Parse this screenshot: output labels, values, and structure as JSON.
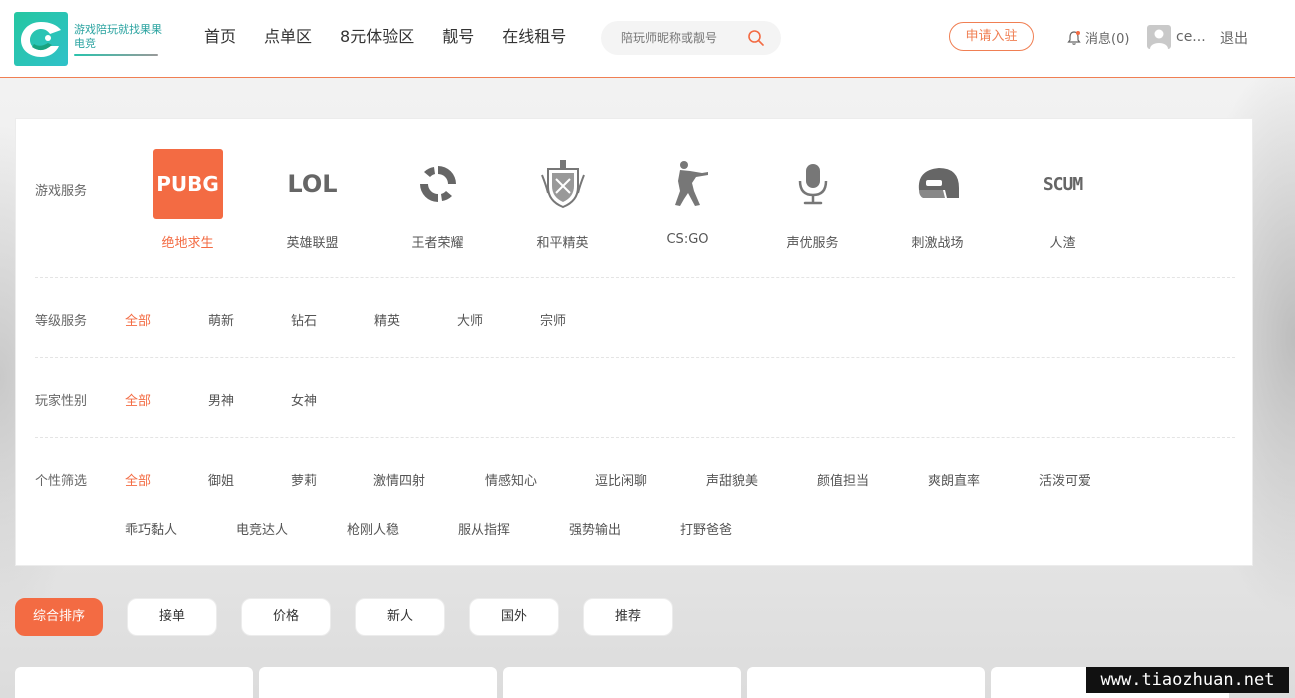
{
  "header": {
    "logo_text": "游戏陪玩就找果果电竞",
    "nav": [
      "首页",
      "点单区",
      "8元体验区",
      "靓号",
      "在线租号"
    ],
    "search_placeholder": "陪玩师昵称或靓号",
    "apply_label": "申请入驻",
    "messages_label": "消息(0)",
    "username": "ce...",
    "logout_label": "退出"
  },
  "filters": {
    "game_label": "游戏服务",
    "games": [
      {
        "name": "绝地求生",
        "icon": "pubg-logo-icon",
        "icon_text": "PUBG",
        "active": true
      },
      {
        "name": "英雄联盟",
        "icon": "lol-logo-icon",
        "icon_text": "LOL",
        "active": false
      },
      {
        "name": "王者荣耀",
        "icon": "honor-of-kings-icon",
        "active": false
      },
      {
        "name": "和平精英",
        "icon": "peace-elite-emblem-icon",
        "active": false
      },
      {
        "name": "CS:GO",
        "icon": "csgo-soldier-icon",
        "active": false
      },
      {
        "name": "声优服务",
        "icon": "microphone-icon",
        "active": false
      },
      {
        "name": "刺激战场",
        "icon": "helmet-icon",
        "active": false
      },
      {
        "name": "人渣",
        "icon": "scum-logo-icon",
        "icon_text": "SCUM",
        "active": false
      }
    ],
    "level_label": "等级服务",
    "levels": [
      "全部",
      "萌新",
      "钻石",
      "精英",
      "大师",
      "宗师"
    ],
    "gender_label": "玩家性别",
    "genders": [
      "全部",
      "男神",
      "女神"
    ],
    "personality_label": "个性筛选",
    "personalities": [
      "全部",
      "御姐",
      "萝莉",
      "激情四射",
      "情感知心",
      "逗比闲聊",
      "声甜貌美",
      "颜值担当",
      "爽朗直率",
      "活泼可爱",
      "乖巧黏人",
      "电竞达人",
      "枪刚人稳",
      "服从指挥",
      "强势输出",
      "打野爸爸"
    ]
  },
  "sorts": [
    "综合排序",
    "接单",
    "价格",
    "新人",
    "国外",
    "推荐"
  ],
  "watermark": "www.tiaozhuan.net",
  "colors": {
    "accent": "#f36b43",
    "header_border": "#f07f53",
    "logo": "#25c7a1"
  }
}
